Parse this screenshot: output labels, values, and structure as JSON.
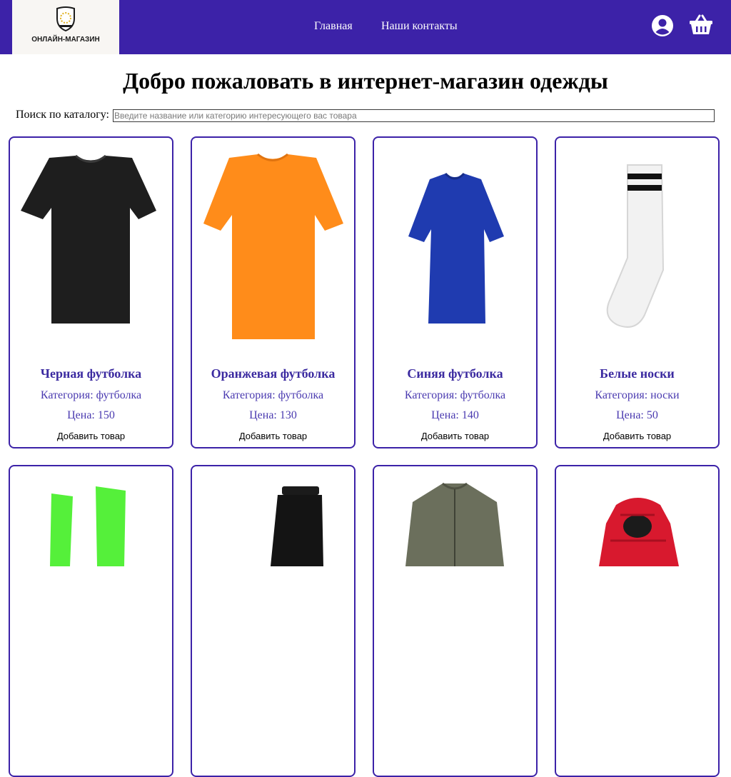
{
  "brand": {
    "logo_text": "ОНЛАЙН-МАГАЗИН"
  },
  "nav": {
    "home": "Главная",
    "contacts": "Наши контакты"
  },
  "page": {
    "title": "Добро пожаловать в интернет-магазин одежды"
  },
  "search": {
    "label": "Поиск по каталогу:",
    "placeholder": "Введите название или категорию интересующего вас товара",
    "value": ""
  },
  "icons": {
    "account": "user-circle-icon",
    "cart": "shopping-basket-icon"
  },
  "colors": {
    "header_bg": "#3c22a8",
    "accent": "#3c22a8",
    "card_text": "#3b2aa0"
  },
  "products": [
    {
      "name": "Черная футболка",
      "category": "Категория: футболка",
      "price": "Цена: 150",
      "add": "Добавить товар",
      "image": "black-tshirt"
    },
    {
      "name": "Оранжевая футболка",
      "category": "Категория: футболка",
      "price": "Цена: 130",
      "add": "Добавить товар",
      "image": "orange-tshirt"
    },
    {
      "name": "Синяя футболка",
      "category": "Категория: футболка",
      "price": "Цена: 140",
      "add": "Добавить товар",
      "image": "blue-tshirt"
    },
    {
      "name": "Белые носки",
      "category": "Категория: носки",
      "price": "Цена: 50",
      "add": "Добавить товар",
      "image": "white-socks"
    },
    {
      "image": "green-socks"
    },
    {
      "image": "black-pants"
    },
    {
      "image": "olive-jacket"
    },
    {
      "image": "red-puffer-jacket"
    }
  ]
}
